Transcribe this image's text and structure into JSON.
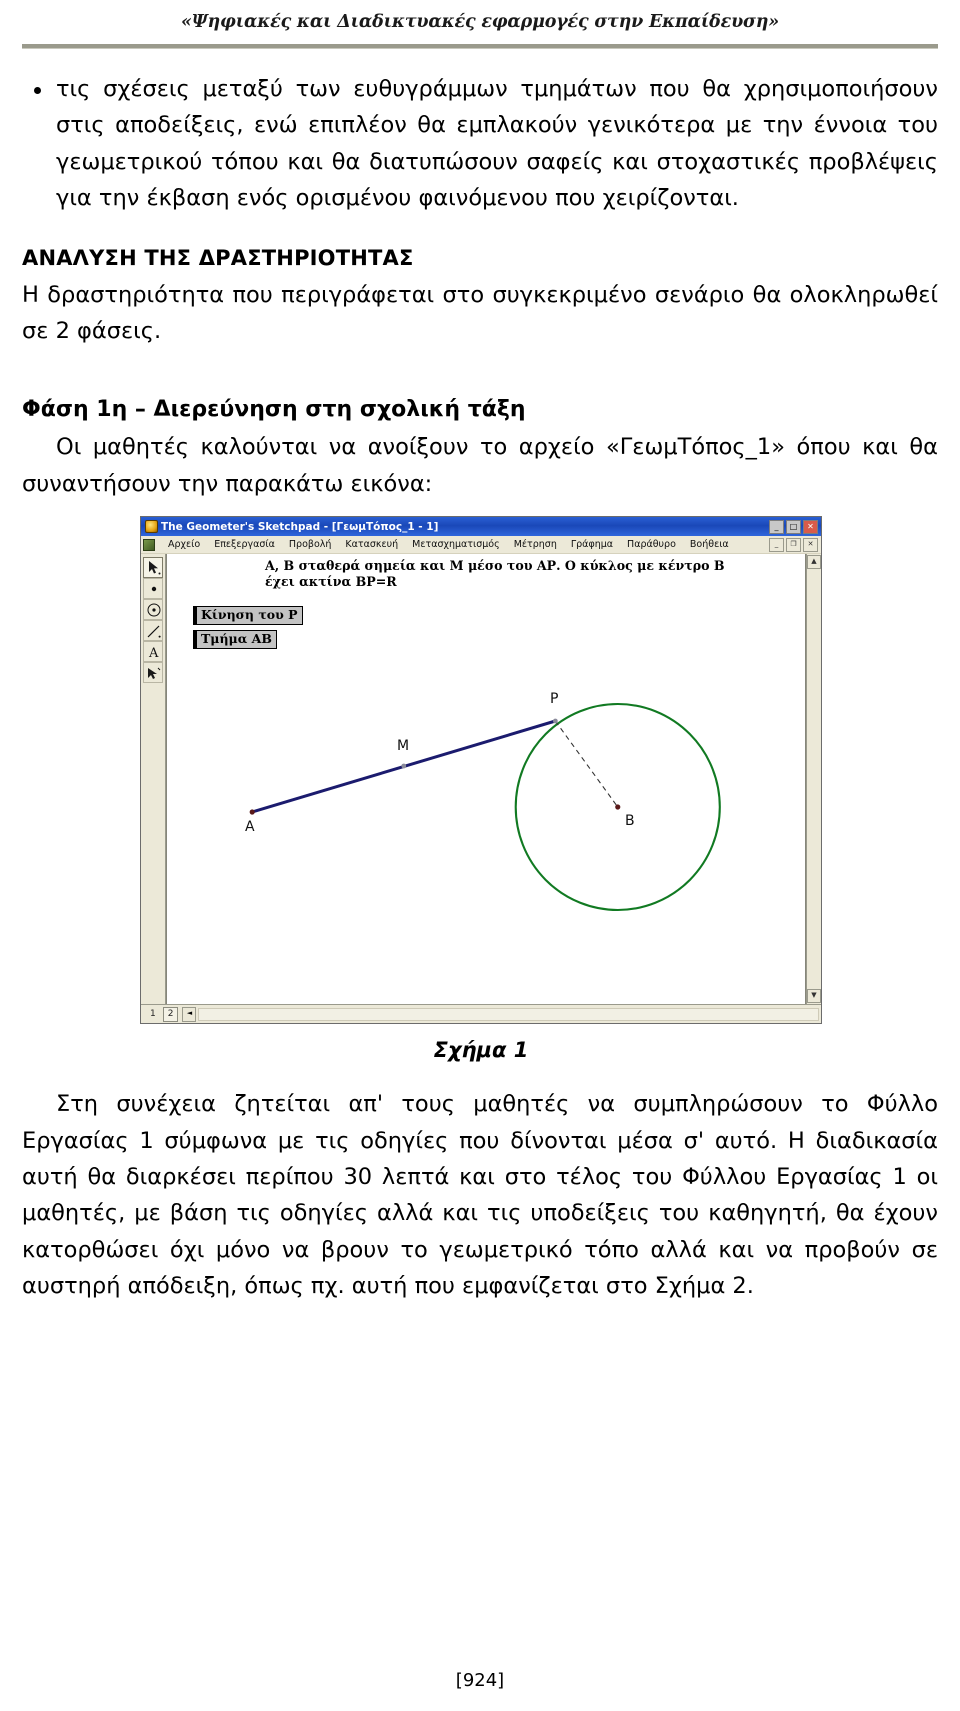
{
  "header": {
    "running_title": "«Ψηφιακές και Διαδικτυακές εφαρμογές στην Εκπαίδευση»"
  },
  "content": {
    "bullet_1": "τις σχέσεις μεταξύ των ευθυγράμμων τμημάτων που θα χρησιμοποιήσουν στις αποδείξεις, ενώ επιπλέον θα εμπλακούν γενικότερα με την έννοια του γεωμετρικού τόπου και θα διατυπώσουν σαφείς και στοχαστικές προβλέψεις για την έκβαση ενός ορισμένου φαινόμενου που χειρίζονται.",
    "section_heading": "ΑΝΑΛΥΣΗ ΤΗΣ ΔΡΑΣΤΗΡΙΟΤΗΤΑΣ",
    "section_para": "Η δραστηριότητα που περιγράφεται στο συγκεκριμένο σενάριο θα ολοκληρωθεί σε 2 φάσεις.",
    "phase_heading": "Φάση 1η – Διερεύνηση στη σχολική τάξη",
    "phase_para": "Οι μαθητές καλούνται να ανοίξουν το αρχείο «ΓεωμΤόπος_1» όπου και θα συναντήσουν την παρακάτω εικόνα:",
    "figure_caption": "Σχήμα 1",
    "tail_para": "Στη συνέχεια ζητείται απ' τους μαθητές να συμπληρώσουν το Φύλλο Εργασίας 1 σύμφωνα με τις οδηγίες που δίνονται μέσα σ' αυτό. Η διαδικασία αυτή θα διαρκέσει περίπου 30 λεπτά και στο τέλος του Φύλλου Εργασίας 1 οι μαθητές, με βάση τις οδηγίες αλλά και τις υποδείξεις του καθηγητή, θα έχουν κατορθώσει όχι μόνο να βρουν το γεωμετρικό τόπο αλλά και να προβούν σε αυστηρή απόδειξη, όπως πχ. αυτή που εμφανίζεται στο Σχήμα 2.",
    "page_number": "[924]"
  },
  "sketchpad": {
    "window_title": "The Geometer's Sketchpad - [ΓεωμΤόπος_1 - 1]",
    "window_buttons": {
      "minimize": "_",
      "maximize": "□",
      "close": "✕"
    },
    "mdi_buttons": {
      "minimize": "_",
      "restore": "❐",
      "close": "✕"
    },
    "menu": [
      "Αρχείο",
      "Επεξεργασία",
      "Προβολή",
      "Κατασκευή",
      "Μετασχηματισμός",
      "Μέτρηση",
      "Γράφημα",
      "Παράθυρο",
      "Βοήθεια"
    ],
    "tools": [
      "arrow-select-tool",
      "point-tool",
      "compass-circle-tool",
      "straightedge-tool",
      "text-tool",
      "custom-tool"
    ],
    "sketch_caption": "Α, Β σταθερά σημεία και Μ μέσο του ΑΡ. Ο κύκλος με κέντρο Β έχει ακτίνα ΒΡ=R",
    "action_buttons": [
      "Κίνηση του Ρ",
      "Τμήμα ΑΒ"
    ],
    "point_labels": {
      "a": "Α",
      "b": "Β",
      "m": "Μ",
      "p": "Ρ"
    },
    "page_tabs": [
      "1",
      "2"
    ],
    "colors": {
      "segment": "#1b1b6e",
      "circle": "#117a22",
      "point": "#5a1a1a",
      "dashed": "#333333",
      "titlebar": "#1a48b8"
    }
  }
}
